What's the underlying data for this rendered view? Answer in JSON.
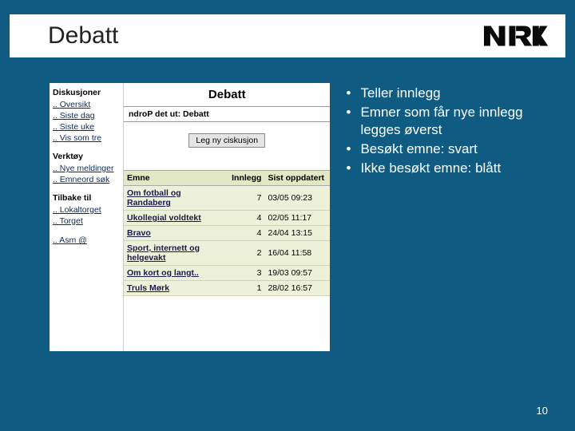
{
  "header": {
    "title": "Debatt"
  },
  "notes": {
    "items": [
      "Teller innlegg",
      "Emner som får nye innlegg legges øverst",
      "Besøkt emne: svart",
      "Ikke besøkt emne: blått"
    ]
  },
  "page_number": "10",
  "forum": {
    "heading": "Debatt",
    "crumb": "ndroP det ut: Debatt",
    "new_btn": "Leg ny ciskusjon",
    "sidebar": {
      "groups": [
        {
          "title": "Diskusjoner",
          "links": [
            "Oversikt",
            "Siste dag",
            "Siste uke",
            "Vis som tre"
          ]
        },
        {
          "title": "Verktøy",
          "links": [
            "Nye meldinger",
            "Emneord søk"
          ]
        },
        {
          "title": "Tilbake til",
          "links": [
            "Lokaltorget",
            "Torget"
          ]
        },
        {
          "title": "",
          "links": [
            "Asm @"
          ]
        }
      ]
    },
    "table": {
      "headers": {
        "emne": "Emne",
        "innlegg": "Innlegg",
        "oppdatert": "Sist oppdatert"
      },
      "rows": [
        {
          "emne": "Om fotball og Randaberg",
          "innlegg": "7",
          "dt": "03/05 09:23"
        },
        {
          "emne": "Ukollegial voldtekt",
          "innlegg": "4",
          "dt": "02/05 11:17"
        },
        {
          "emne": "Bravo",
          "innlegg": "4",
          "dt": "24/04 13:15"
        },
        {
          "emne": "Sport, internett og helgevakt",
          "innlegg": "2",
          "dt": "16/04 11:58"
        },
        {
          "emne": "Om kort og langt..",
          "innlegg": "3",
          "dt": "19/03 09:57"
        },
        {
          "emne": "Truls Mørk",
          "innlegg": "1",
          "dt": "28/02 16:57"
        }
      ]
    }
  }
}
